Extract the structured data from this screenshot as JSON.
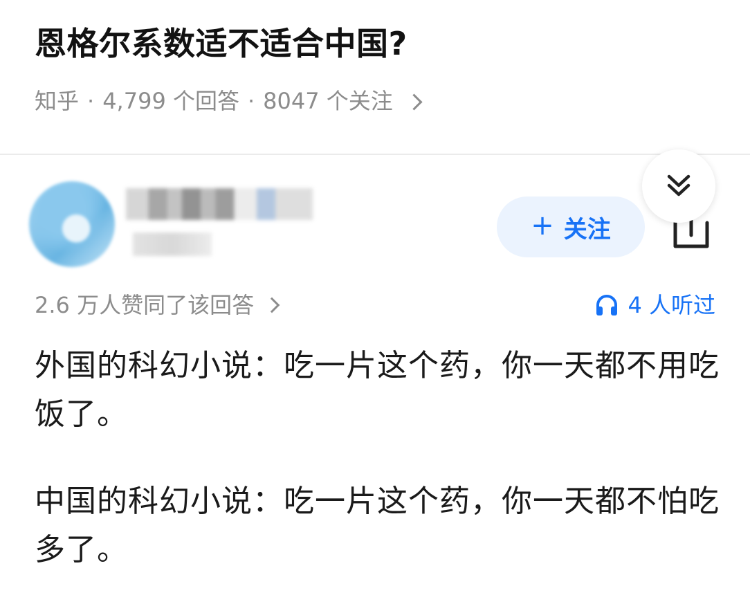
{
  "question": {
    "title": "恩格尔系数适不适合中国?",
    "source": "知乎",
    "answer_count": "4,799 个回答",
    "follower_count": "8047 个关注",
    "separator": "·"
  },
  "answer": {
    "follow_button": {
      "plus": "+",
      "label": "关注"
    },
    "vote_summary": "2.6 万人赞同了该回答",
    "listen_count": "4 人听过",
    "paragraphs": [
      "外国的科幻小说：吃一片这个药，你一天都不用吃饭了。",
      "中国的科幻小说：吃一片这个药，你一天都不怕吃多了。"
    ]
  },
  "icons": {
    "collapse": "double-chevron-down-icon",
    "share": "share-icon",
    "headphones": "headphones-icon",
    "chevron": "chevron-right-icon"
  },
  "colors": {
    "accent": "#1772f6",
    "follow_bg": "#ebf3fe",
    "meta_text": "#8c8c8c",
    "title_text": "#121212"
  }
}
